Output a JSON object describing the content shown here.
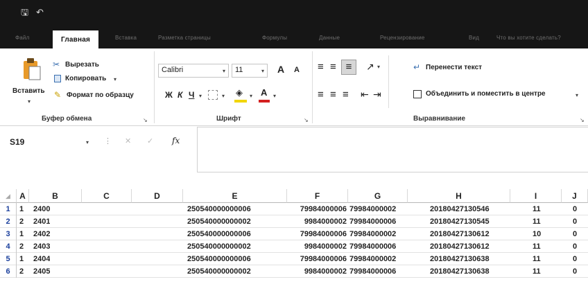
{
  "quick_access": {
    "save_icon": "save-icon",
    "undo_icon": "undo-icon",
    "save_glyph": "🖫",
    "undo_glyph": "↶"
  },
  "tabs": [
    "Файл",
    "Главная",
    "Вставка",
    "Разметка страницы",
    "Формулы",
    "Данные",
    "Рецензирование",
    "Вид",
    "Что вы хотите сделать?"
  ],
  "clipboard": {
    "paste": "Вставить",
    "cut": "Вырезать",
    "copy": "Копировать",
    "format_painter": "Формат по образцу",
    "group": "Буфер обмена"
  },
  "font": {
    "name": "Calibri",
    "size": "11",
    "grow": "A",
    "shrink": "A",
    "bold": "Ж",
    "italic": "К",
    "underline": "Ч",
    "font_color_letter": "A",
    "group": "Шрифт"
  },
  "alignment": {
    "wrap": "Перенести текст",
    "merge": "Объединить и поместить в центре",
    "group": "Выравнивание"
  },
  "formula_bar": {
    "cell_ref": "S19",
    "fx": "fx",
    "value": ""
  },
  "columns": [
    "A",
    "B",
    "C",
    "D",
    "E",
    "F",
    "G",
    "H",
    "I",
    "J"
  ],
  "rows": [
    {
      "num": "1",
      "A": "1",
      "B": "2400",
      "E": "250540000000006",
      "F": "79984000006",
      "G": "79984000002",
      "H": "20180427130546",
      "I": "11",
      "J": "0"
    },
    {
      "num": "2",
      "A": "2",
      "B": "2401",
      "E": "250540000000002",
      "F": "9984000002",
      "G": "79984000006",
      "H": "20180427130545",
      "I": "11",
      "J": "0"
    },
    {
      "num": "3",
      "A": "1",
      "B": "2402",
      "E": "250540000000006",
      "F": "79984000006",
      "G": "79984000002",
      "H": "20180427130612",
      "I": "10",
      "J": "0"
    },
    {
      "num": "4",
      "A": "2",
      "B": "2403",
      "E": "250540000000002",
      "F": "9984000002",
      "G": "79984000006",
      "H": "20180427130612",
      "I": "11",
      "J": "0"
    },
    {
      "num": "5",
      "A": "1",
      "B": "2404",
      "E": "250540000000006",
      "F": "79984000006",
      "G": "79984000002",
      "H": "20180427130638",
      "I": "11",
      "J": "0"
    },
    {
      "num": "6",
      "A": "2",
      "B": "2405",
      "E": "250540000000002",
      "F": "9984000002",
      "G": "79984000006",
      "H": "20180427130638",
      "I": "11",
      "J": "0"
    }
  ],
  "colors": {
    "dark": "#161616",
    "row_number": "#1a3f9c",
    "fill_yellow": "#f2d600",
    "font_red": "#d42020",
    "paste_orange": "#e89a2a"
  }
}
